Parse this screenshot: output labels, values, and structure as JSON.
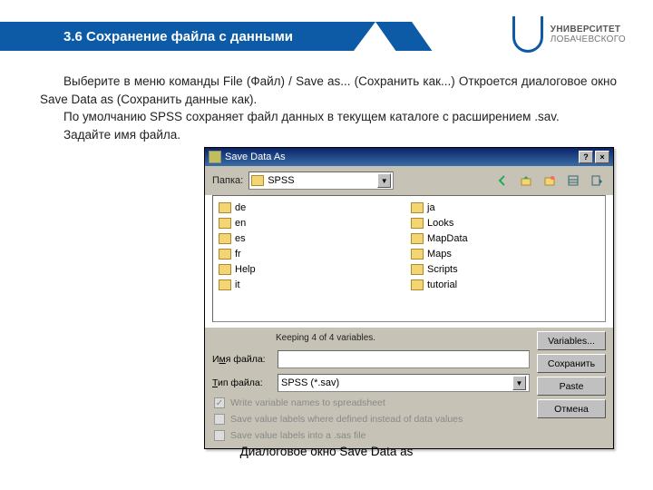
{
  "header": {
    "title": "3.6 Сохранение файла с данными"
  },
  "logo": {
    "line1": "УНИВЕРСИТЕТ",
    "line2": "ЛОБАЧЕВСКОГО"
  },
  "body": {
    "p1": "Выберите в меню команды File (Файл) / Save as... (Сохранить как...) Откроется диалоговое окно Save Data as (Сохранить данные как).",
    "p2": "По умолчанию SPSS сохраняет файл данных в текущем каталоге с расширением .sav.",
    "p3": "Задайте имя файла."
  },
  "dialog": {
    "title": "Save Data As",
    "folder_label": "Папка:",
    "folder_value": "SPSS",
    "toolbar_back": "←",
    "folders_left": [
      "de",
      "en",
      "es",
      "fr",
      "Help",
      "it"
    ],
    "folders_right": [
      "ja",
      "Looks",
      "MapData",
      "Maps",
      "Scripts",
      "tutorial"
    ],
    "keeping": "Keeping 4 of 4 variables.",
    "filename_label_pre": "И",
    "filename_label_u": "м",
    "filename_label_post": "я файла:",
    "filetype_label_pre": "",
    "filetype_label_u": "Т",
    "filetype_label_post": "ип файла:",
    "filetype_value": "SPSS (*.sav)",
    "chk1": "Write variable names to spreadsheet",
    "chk2": "Save value labels where defined instead of data values",
    "chk3": "Save value labels into a .sas file",
    "btn_variables": "Variables...",
    "btn_save": "Сохранить",
    "btn_paste": "Paste",
    "btn_cancel": "Отмена"
  },
  "caption": "Диалоговое окно Save Data as"
}
